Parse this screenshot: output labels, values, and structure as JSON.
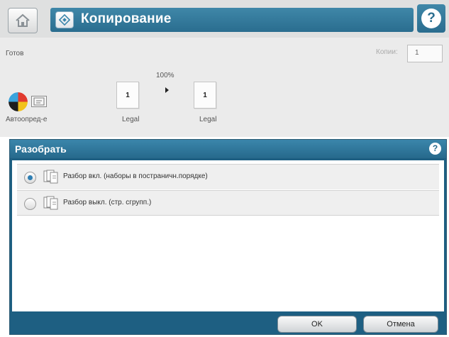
{
  "header": {
    "title": "Копирование",
    "home_icon": "home-icon",
    "app_icon": "copy-icon",
    "help_icon": "help-icon"
  },
  "status": {
    "ready": "Готов",
    "copies_label": "Копии:",
    "copies_value": "1"
  },
  "preview": {
    "zoom": "100%",
    "source_page_number": "1",
    "dest_page_number": "1",
    "source_size": "Legal",
    "dest_size": "Legal",
    "color_mode_label": "Автоопред-е"
  },
  "panel": {
    "title": "Разобрать",
    "options": [
      {
        "label": "Разбор вкл. (наборы в постраничн.порядке)",
        "selected": true
      },
      {
        "label": "Разбор выкл. (стр. сгрупп.)",
        "selected": false
      }
    ],
    "ok_label": "OK",
    "cancel_label": "Отмена"
  },
  "colors": {
    "accent": "#2a6d8f",
    "panel_border": "#1e5f82"
  }
}
